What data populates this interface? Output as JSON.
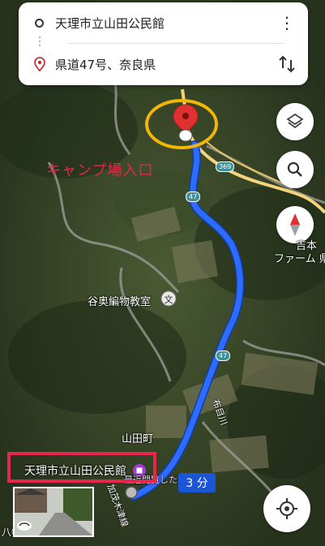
{
  "search": {
    "origin": "天理市立山田公民館",
    "destination": "県道47号、奈良県"
  },
  "map": {
    "annotation_label": "キャンプ場入口",
    "poi_workshop": "谷奥編物教室",
    "town": "山田町",
    "hall_label": "天理市立山田公民館",
    "hall_sub": "最近閲覧した場所",
    "farm_line1": "吉本",
    "farm_line2": "ファーム 県",
    "stream1": "布目川",
    "stream2": "加茂木津線",
    "shrine": "八幡神社",
    "road_369": "369",
    "road_47a": "47",
    "road_47b": "47"
  },
  "route": {
    "duration": "3 分",
    "color": "#1a56d6"
  },
  "colors": {
    "annotation": "#e8254a",
    "highlight_ring": "#f2b705",
    "pin": "#e0302f"
  },
  "icons": {
    "layers": "layers-icon",
    "search": "search-icon",
    "compass": "compass-icon",
    "location": "my-location-icon",
    "swap": "swap-icon",
    "menu": "more-vert-icon"
  }
}
